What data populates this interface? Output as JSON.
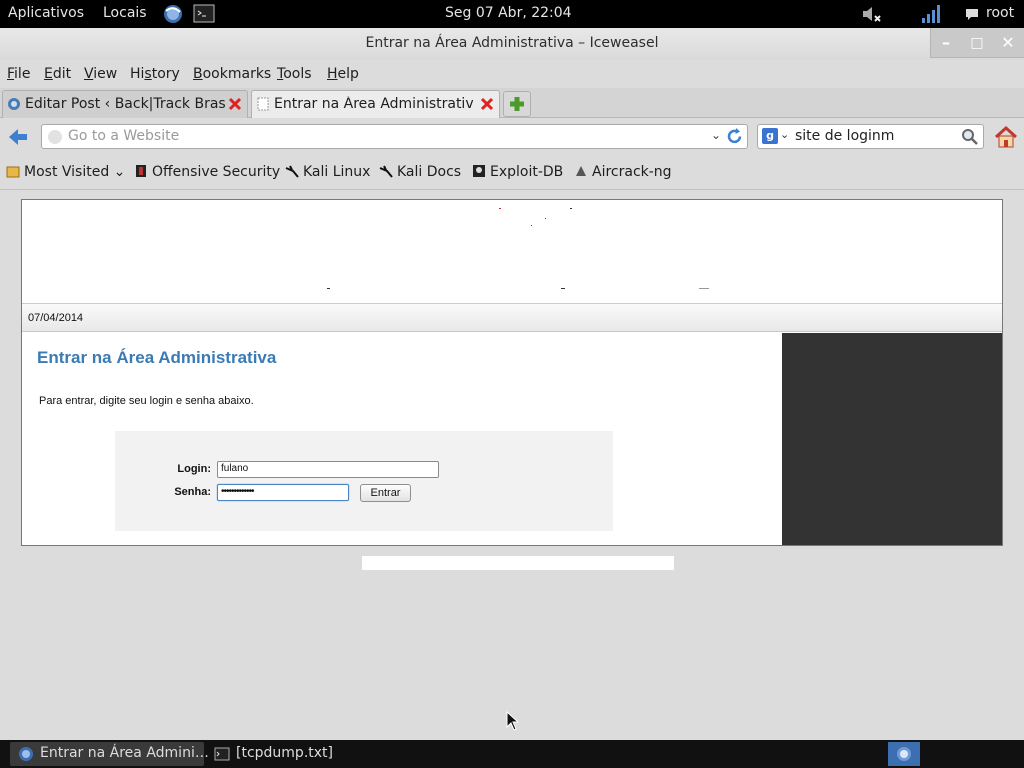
{
  "topbar": {
    "apps_label": "Aplicativos",
    "places_label": "Locais",
    "clock": "Seg 07 Abr, 22:04",
    "user": "root"
  },
  "window": {
    "title": "Entrar na Área Administrativa – Iceweasel",
    "minimize": "–",
    "maximize": "□",
    "close": "✕"
  },
  "menu": {
    "items": [
      "File",
      "Edit",
      "View",
      "History",
      "Bookmarks",
      "Tools",
      "Help"
    ],
    "mnemonics": [
      "F",
      "E",
      "V",
      "s",
      "B",
      "T",
      "H"
    ]
  },
  "tabs": [
    {
      "label": "Editar Post ‹ Back|Track Bras…",
      "active": false
    },
    {
      "label": "Entrar na Área Administrativa",
      "active": true
    }
  ],
  "nav": {
    "url_placeholder": "Go to a Website",
    "search_value": "site de loginm",
    "search_engine": "g"
  },
  "bookmarks": [
    {
      "label": "Most Visited",
      "icon": "folder-icon",
      "dropdown": true
    },
    {
      "label": "Offensive Security",
      "icon": "offsec-icon"
    },
    {
      "label": "Kali Linux",
      "icon": "dragon-icon"
    },
    {
      "label": "Kali Docs",
      "icon": "dragon-icon"
    },
    {
      "label": "Exploit-DB",
      "icon": "exploitdb-icon"
    },
    {
      "label": "Aircrack-ng",
      "icon": "antenna-icon"
    }
  ],
  "page": {
    "date": "07/04/2014",
    "heading": "Entrar na Área Administrativa",
    "intro": "Para entrar, digite seu login e senha abaixo.",
    "login_label": "Login:",
    "login_value": "fulano",
    "password_label": "Senha:",
    "password_value": "•••••••••••••",
    "submit_label": "Entrar"
  },
  "taskbar": {
    "items": [
      {
        "label": "Entrar na Área Admini…",
        "icon": "iceweasel-icon",
        "active": true
      },
      {
        "label": "[tcpdump.txt]",
        "icon": "terminal-icon",
        "active": false
      }
    ]
  },
  "colors": {
    "heading": "#3b7bb4",
    "sidebar": "#333333",
    "taskbar_tray": "#3d6fb0"
  }
}
